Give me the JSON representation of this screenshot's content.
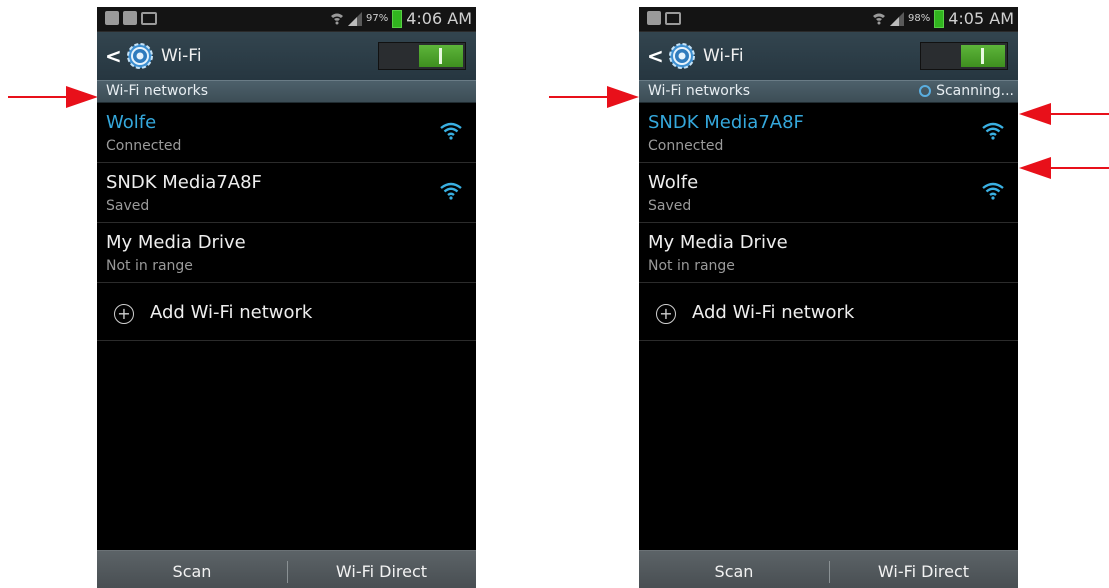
{
  "left_screen": {
    "status_time": "4:06 AM",
    "battery_pct": "97%",
    "title": "Wi-Fi",
    "section_label": "Wi-Fi networks",
    "networks": [
      {
        "name": "Wolfe",
        "status": "Connected",
        "has_signal": true
      },
      {
        "name": "SNDK Media7A8F",
        "status": "Saved",
        "has_signal": true
      },
      {
        "name": "My Media Drive",
        "status": "Not in range",
        "has_signal": false
      }
    ],
    "add_label": "Add Wi-Fi network",
    "scan_label": "Scan",
    "wifi_direct_label": "Wi-Fi Direct"
  },
  "right_screen": {
    "status_time": "4:05 AM",
    "battery_pct": "98%",
    "title": "Wi-Fi",
    "section_label": "Wi-Fi networks",
    "scanning_label": "Scanning...",
    "networks": [
      {
        "name": "SNDK Media7A8F",
        "status": "Connected",
        "has_signal": true
      },
      {
        "name": "Wolfe",
        "status": "Saved",
        "has_signal": true
      },
      {
        "name": "My Media Drive",
        "status": "Not in range",
        "has_signal": false
      }
    ],
    "add_label": "Add Wi-Fi network",
    "scan_label": "Scan",
    "wifi_direct_label": "Wi-Fi Direct"
  },
  "colors": {
    "annotation_arrow": "#e8101a",
    "connected_network": "#35a8dc",
    "toggle_on": "#4fa52c",
    "battery": "#31b51f"
  },
  "icons": [
    "back-chevron-icon",
    "settings-gear-icon",
    "wifi-signal-icon",
    "add-circle-icon",
    "red-arrow-icon"
  ]
}
